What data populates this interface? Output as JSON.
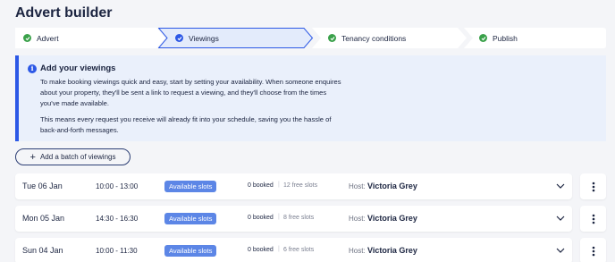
{
  "header": {
    "title": "Advert builder"
  },
  "stepper": {
    "steps": [
      {
        "label": "Advert",
        "state": "complete"
      },
      {
        "label": "Viewings",
        "state": "current"
      },
      {
        "label": "Tenancy conditions",
        "state": "complete"
      },
      {
        "label": "Publish",
        "state": "complete"
      }
    ]
  },
  "info": {
    "icon": "info-icon",
    "icon_glyph": "i",
    "title": "Add your viewings",
    "paragraph1_line1": "To make booking viewings quick and easy, start by setting your availability. When someone enquires",
    "paragraph1_line2": "about your property, they'll be sent a link to request a viewing, and they'll choose from the times",
    "paragraph1_line3": "you've made available.",
    "paragraph2_line1": "This means every request you receive will already fit into your schedule, saving you the hassle of",
    "paragraph2_line2": "back-and-forth messages."
  },
  "batch_button": {
    "plus": "+",
    "label": "Add a batch of viewings"
  },
  "viewings": [
    {
      "date": "Tue 06 Jan",
      "time": "10:00 - 13:00",
      "badge": "Available slots",
      "booked": "0 booked",
      "free": "12 free slots",
      "host_label": "Host:",
      "host": "Victoria Grey"
    },
    {
      "date": "Mon 05 Jan",
      "time": "14:30 - 16:30",
      "badge": "Available slots",
      "booked": "0 booked",
      "free": "8 free slots",
      "host_label": "Host:",
      "host": "Victoria Grey"
    },
    {
      "date": "Sun 04 Jan",
      "time": "10:00 - 11:30",
      "badge": "Available slots",
      "booked": "0 booked",
      "free": "6 free slots",
      "host_label": "Host:",
      "host": "Victoria Grey"
    }
  ],
  "colors": {
    "accent": "#2c58e6",
    "complete": "#3aa14a",
    "badge": "#5c86e6",
    "current_step_bg": "#e3ebfb"
  }
}
